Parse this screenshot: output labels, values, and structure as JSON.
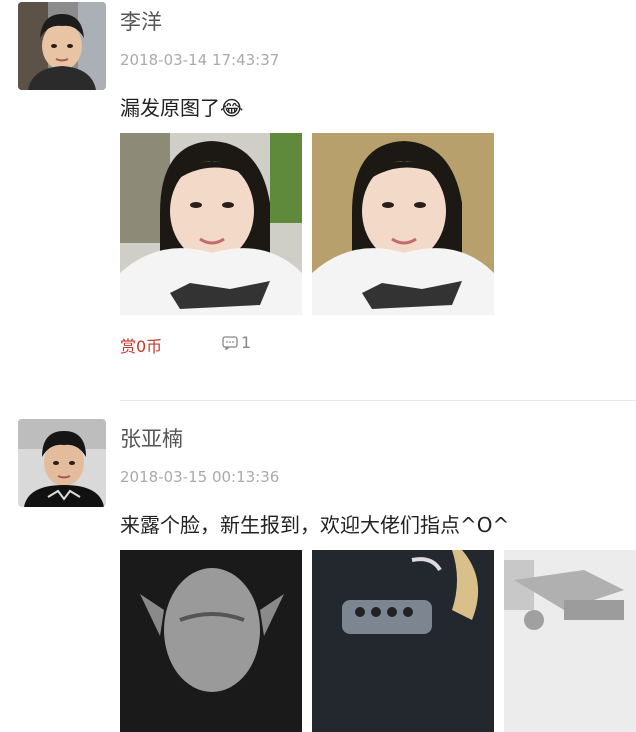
{
  "posts": [
    {
      "username": "李洋",
      "timestamp": "2018-03-14 17:43:37",
      "text": "漏发原图了",
      "emoji": "😂",
      "reward_label": "赏0币",
      "comment_count": "1",
      "avatar_icon": "avatar-icon",
      "comment_icon": "comment-icon"
    },
    {
      "username": "张亚楠",
      "timestamp": "2018-03-15 00:13:36",
      "text": "来露个脸，新生报到，欢迎大佬们指点^O^",
      "avatar_icon": "avatar-icon"
    }
  ],
  "colors": {
    "reward": "#c23a2b",
    "username": "#555555",
    "timestamp": "#aaaaaa",
    "divider": "#e6e6e6"
  }
}
